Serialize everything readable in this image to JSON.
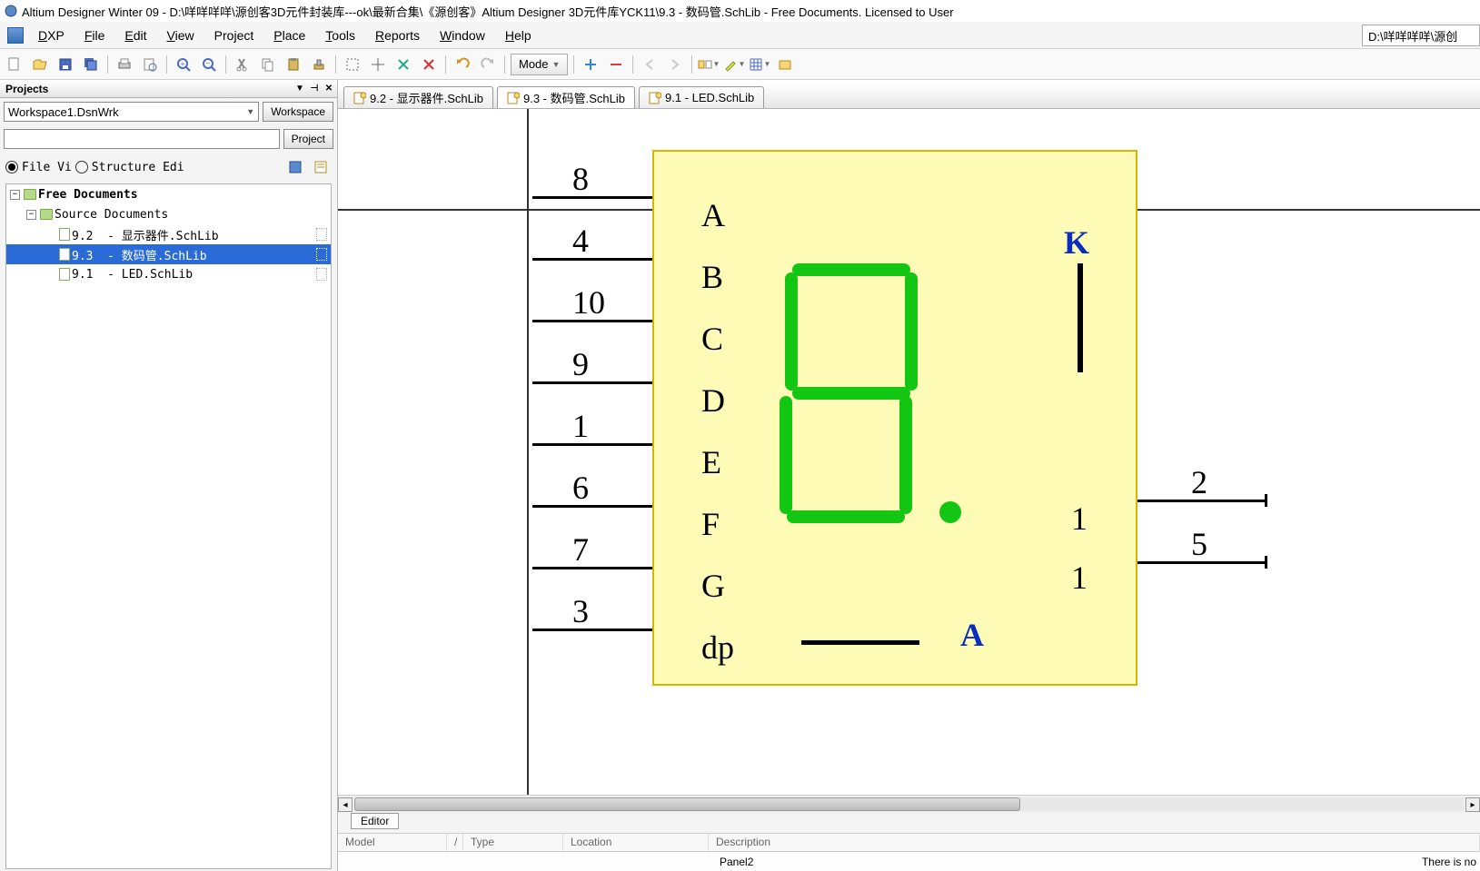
{
  "title": "Altium Designer Winter 09 - D:\\咩咩咩咩\\源创客3D元件封装库---ok\\最新合集\\《源创客》Altium Designer 3D元件库YCK11\\9.3  - 数码管.SchLib - Free Documents. Licensed to User",
  "path_right": "D:\\咩咩咩咩\\源创",
  "menu": {
    "dxp": "DXP",
    "file": "File",
    "edit": "Edit",
    "view": "View",
    "project": "Project",
    "place": "Place",
    "tools": "Tools",
    "reports": "Reports",
    "window": "Window",
    "help": "Help"
  },
  "toolbar": {
    "mode_label": "Mode"
  },
  "projects": {
    "panel_title": "Projects",
    "workspace_value": "Workspace1.DsnWrk",
    "workspace_btn": "Workspace",
    "project_btn": "Project",
    "file_view": "File Vi",
    "structure_edit": "Structure Edi",
    "tree": {
      "root": "Free Documents",
      "src": "Source Documents",
      "docs": [
        {
          "name": "9.2  - 显示器件.SchLib"
        },
        {
          "name": "9.3  - 数码管.SchLib"
        },
        {
          "name": "9.1  - LED.SchLib"
        }
      ]
    }
  },
  "tabs": [
    {
      "label": "9.2  - 显示器件.SchLib"
    },
    {
      "label": "9.3  - 数码管.SchLib"
    },
    {
      "label": "9.1  - LED.SchLib"
    }
  ],
  "schematic": {
    "left_pins": [
      {
        "num": "8",
        "name": "A"
      },
      {
        "num": "4",
        "name": "B"
      },
      {
        "num": "10",
        "name": "C"
      },
      {
        "num": "9",
        "name": "D"
      },
      {
        "num": "1",
        "name": "E"
      },
      {
        "num": "6",
        "name": "F"
      },
      {
        "num": "7",
        "name": "G"
      },
      {
        "num": "3",
        "name": "dp"
      }
    ],
    "right_top_label": "K",
    "right_nums": [
      "1",
      "1"
    ],
    "right_bottom_label": "A",
    "right_pins": [
      "2",
      "5"
    ]
  },
  "editor_tab": "Editor",
  "model_cols": {
    "model": "Model",
    "type": "Type",
    "location": "Location",
    "description": "Description"
  },
  "status": {
    "panel": "Panel2",
    "msg": "There is no "
  }
}
